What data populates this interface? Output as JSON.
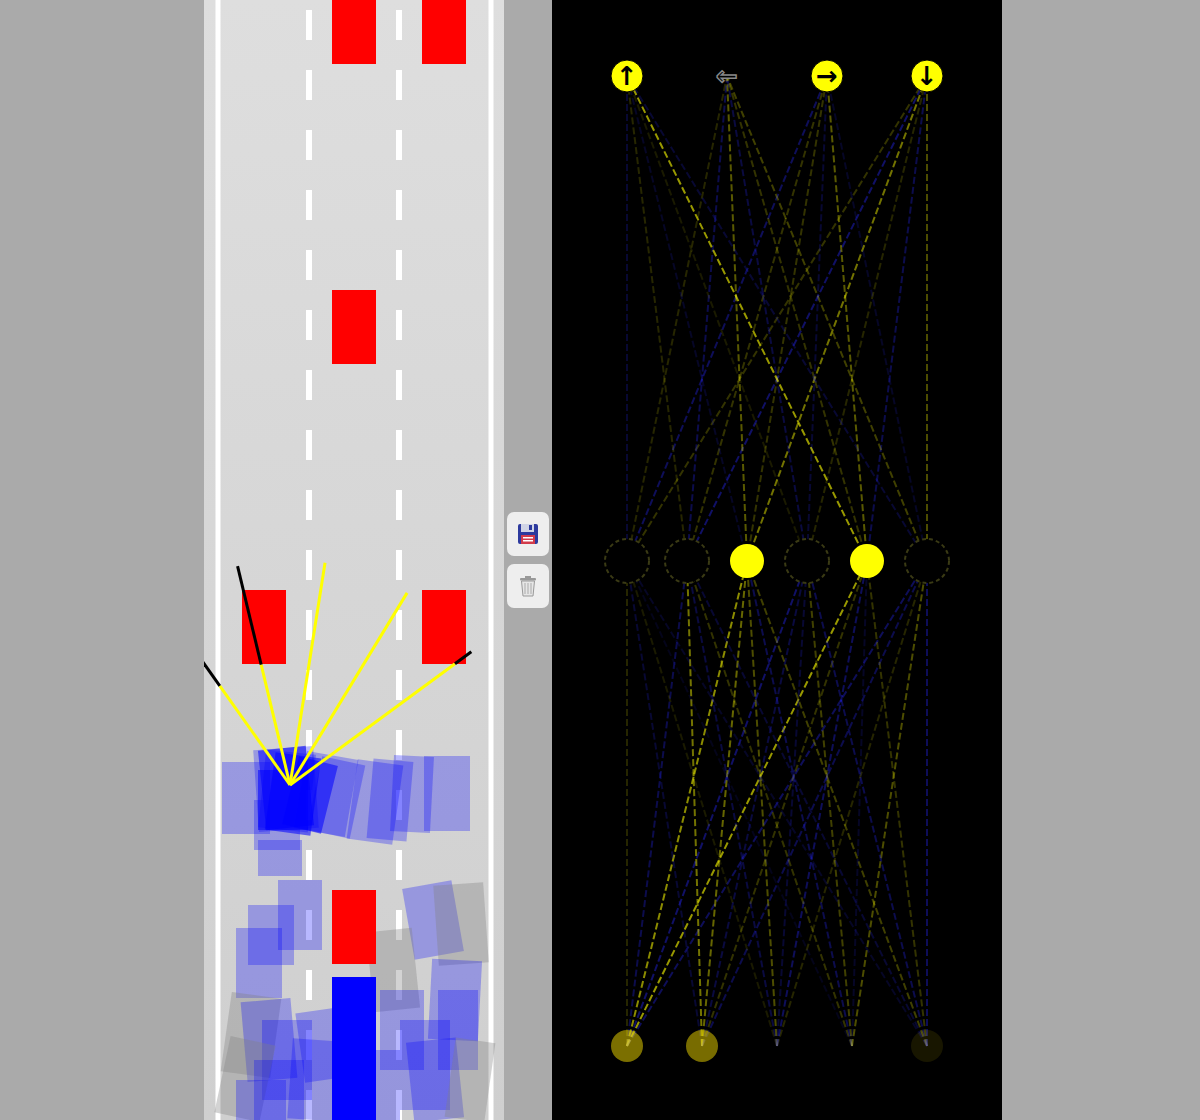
{
  "outputs": [
    {
      "label": "↑",
      "active": true
    },
    {
      "label": "←",
      "active": false
    },
    {
      "label": "→",
      "active": true
    },
    {
      "label": "↓",
      "active": true
    }
  ],
  "hidden": [
    {
      "active": false
    },
    {
      "active": false
    },
    {
      "active": true
    },
    {
      "active": false
    },
    {
      "active": true
    },
    {
      "active": false
    }
  ],
  "sensors": [
    {
      "level": 0.46
    },
    {
      "level": 0.45
    },
    {
      "level": 0
    },
    {
      "level": 0
    },
    {
      "level": 0.09
    }
  ],
  "weights_input_hidden": [
    [
      0.15,
      -0.3,
      0.55,
      -0.4,
      0.6,
      -0.35
    ],
    [
      -0.2,
      0.45,
      0.4,
      -0.25,
      0.2,
      -0.3
    ],
    [
      0.1,
      -0.25,
      0.3,
      -0.2,
      -0.35,
      0.15
    ],
    [
      -0.1,
      0.2,
      -0.3,
      0.25,
      -0.15,
      0.3
    ],
    [
      -0.15,
      -0.2,
      0.25,
      -0.3,
      0.2,
      -0.35
    ]
  ],
  "weights_hidden_output": [
    [
      -0.2,
      0.15,
      -0.35,
      0.2
    ],
    [
      0.15,
      -0.3,
      0.2,
      -0.4
    ],
    [
      -0.15,
      0.35,
      0.2,
      0.45
    ],
    [
      0.1,
      -0.25,
      -0.2,
      0.15
    ],
    [
      0.6,
      0.2,
      0.35,
      -0.3
    ],
    [
      -0.2,
      0.25,
      -0.15,
      0.3
    ]
  ],
  "controls": [
    {
      "kind": "save"
    },
    {
      "kind": "discard"
    }
  ]
}
